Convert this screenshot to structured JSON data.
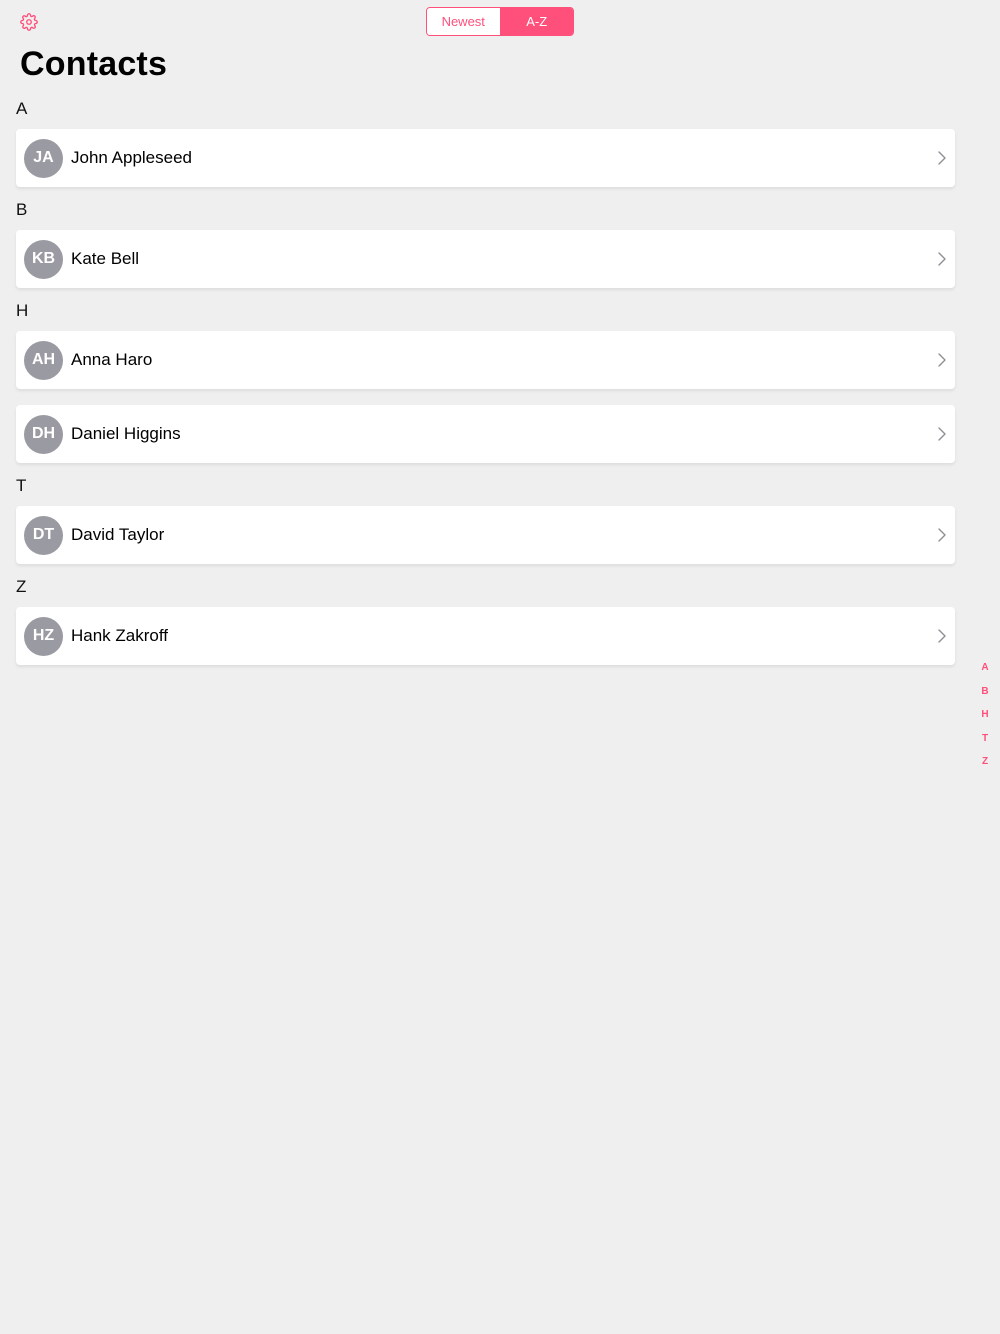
{
  "header": {
    "settings_icon": "gear-icon",
    "sort_options": [
      "Newest",
      "A-Z"
    ],
    "selected_sort": "A-Z"
  },
  "title": "Contacts",
  "accent_color": "#ff4f7b",
  "avatar_color": "#9a9aa2",
  "sections": [
    {
      "letter": "A",
      "contacts": [
        {
          "initials": "JA",
          "name": "John Appleseed"
        }
      ]
    },
    {
      "letter": "B",
      "contacts": [
        {
          "initials": "KB",
          "name": "Kate Bell"
        }
      ]
    },
    {
      "letter": "H",
      "contacts": [
        {
          "initials": "AH",
          "name": "Anna Haro"
        },
        {
          "initials": "DH",
          "name": "Daniel Higgins"
        }
      ]
    },
    {
      "letter": "T",
      "contacts": [
        {
          "initials": "DT",
          "name": "David Taylor"
        }
      ]
    },
    {
      "letter": "Z",
      "contacts": [
        {
          "initials": "HZ",
          "name": "Hank Zakroff"
        }
      ]
    }
  ],
  "index_letters": [
    "A",
    "B",
    "H",
    "T",
    "Z"
  ]
}
